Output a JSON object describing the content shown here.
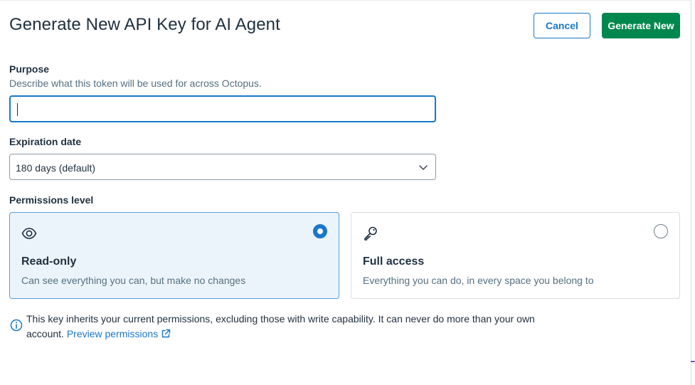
{
  "dialog": {
    "title": "Generate New API Key for AI Agent",
    "cancel_label": "Cancel",
    "generate_label": "Generate New"
  },
  "purpose": {
    "label": "Purpose",
    "help": "Describe what this token will be used for across Octopus.",
    "value": ""
  },
  "expiration": {
    "label": "Expiration date",
    "selected": "180 days (default)"
  },
  "permissions": {
    "label": "Permissions level",
    "options": [
      {
        "icon": "eye-icon",
        "title": "Read-only",
        "description": "Can see everything you can, but make no changes",
        "selected": true
      },
      {
        "icon": "key-icon",
        "title": "Full access",
        "description": "Everything you can do, in every space you belong to",
        "selected": false
      }
    ]
  },
  "info": {
    "text": "This key inherits your current permissions, excluding those with write capability. It can never do more than your own account.",
    "link_label": "Preview permissions"
  },
  "colors": {
    "primary": "#1a77ca",
    "success": "#00874d",
    "selected_bg": "#ecf4fb"
  }
}
